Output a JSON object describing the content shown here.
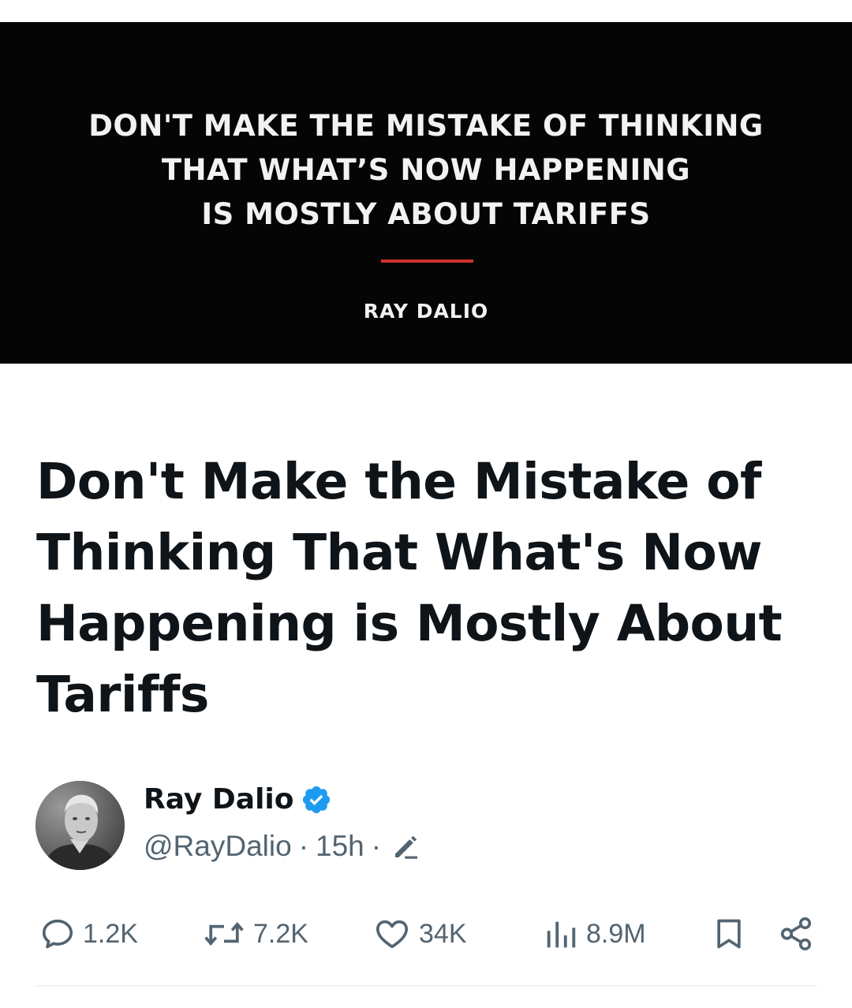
{
  "hero": {
    "quote_lines": [
      "DON'T MAKE THE MISTAKE OF THINKING",
      "THAT WHAT’S NOW HAPPENING",
      "IS MOSTLY ABOUT TARIFFS"
    ],
    "author": "RAY DALIO",
    "accent_color": "#d2322d"
  },
  "article": {
    "title": "Don't Make the Mistake of Thinking That What's Now Happening is Mostly About Tariffs"
  },
  "post": {
    "author_name": "Ray Dalio",
    "handle": "@RayDalio",
    "time": "15h",
    "separator": "·",
    "verified_icon": "verified-badge-icon",
    "verified_color": "#1d9bf0"
  },
  "actions": {
    "replies": "1.2K",
    "reposts": "7.2K",
    "likes": "34K",
    "views": "8.9M"
  }
}
